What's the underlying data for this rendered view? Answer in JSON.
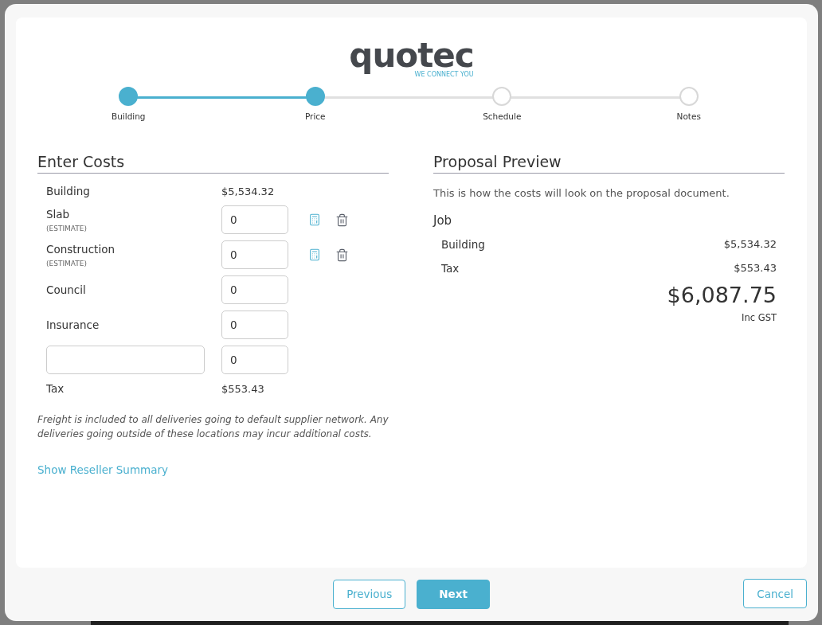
{
  "logo": {
    "name": "quotec",
    "tagline": "WE CONNECT YOU"
  },
  "steps": [
    {
      "label": "Building",
      "completed": true
    },
    {
      "label": "Price",
      "completed": true
    },
    {
      "label": "Schedule",
      "completed": false
    },
    {
      "label": "Notes",
      "completed": false
    }
  ],
  "enter_costs": {
    "title": "Enter Costs",
    "rows": [
      {
        "kind": "amount",
        "label": "Building",
        "value": "$5,534.32"
      },
      {
        "kind": "input",
        "label": "Slab",
        "note": "(ESTIMATE)",
        "value": "0",
        "tools": true
      },
      {
        "kind": "input",
        "label": "Construction",
        "note": "(ESTIMATE)",
        "value": "0",
        "tools": true
      },
      {
        "kind": "input",
        "label": "Council",
        "value": "0",
        "tools": false
      },
      {
        "kind": "input",
        "label": "Insurance",
        "value": "0",
        "tools": false
      },
      {
        "kind": "custom",
        "value": "0"
      },
      {
        "kind": "amount",
        "label": "Tax",
        "value": "$553.43"
      }
    ],
    "disclaimer": "Freight is included to all deliveries going to default supplier network. Any deliveries going outside of these locations may incur additional costs.",
    "link": "Show Reseller Summary"
  },
  "proposal_preview": {
    "title": "Proposal Preview",
    "description": "This is how the costs will look on the proposal document.",
    "section": "Job",
    "lines": [
      {
        "label": "Building",
        "value": "$5,534.32"
      },
      {
        "label": "Tax",
        "value": "$553.43"
      }
    ],
    "total": "$6,087.75",
    "total_note": "Inc GST"
  },
  "footer": {
    "previous": "Previous",
    "next": "Next",
    "cancel": "Cancel"
  }
}
